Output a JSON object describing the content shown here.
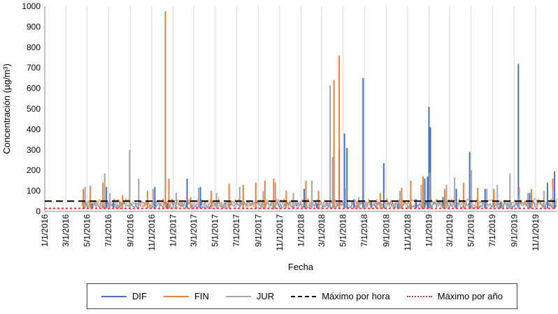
{
  "chart_data": {
    "type": "line",
    "xlabel": "Fecha",
    "ylabel": "Concentración (µg/m³)",
    "ylim": [
      0,
      1000
    ],
    "yticks": [
      "0",
      "100",
      "200",
      "300",
      "400",
      "500",
      "600",
      "700",
      "800",
      "900",
      "1000"
    ],
    "xticks": [
      "1/1/2016",
      "3/1/2016",
      "5/1/2016",
      "7/1/2016",
      "9/1/2016",
      "11/1/2016",
      "1/1/2017",
      "3/1/2017",
      "5/1/2017",
      "7/1/2017",
      "9/1/2017",
      "11/1/2017",
      "1/1/2018",
      "3/1/2018",
      "5/1/2018",
      "7/1/2018",
      "9/1/2018",
      "11/1/2018",
      "1/1/2019",
      "3/1/2019",
      "5/1/2019",
      "7/1/2019",
      "9/1/2019",
      "11/1/2019"
    ],
    "xlim": [
      "2016-01-01",
      "2019-12-31"
    ],
    "grid": "vertical",
    "legend_position": "bottom",
    "series": [
      {
        "name": "DIF",
        "color": "#4472c4",
        "x": [
          "2016-05-15",
          "2016-06-25",
          "2016-07-15",
          "2016-11-10",
          "2016-12-15",
          "2017-02-10",
          "2017-03-20",
          "2018-01-10",
          "2018-02-15",
          "2018-04-20",
          "2018-05-05",
          "2018-05-12",
          "2018-06-01",
          "2018-06-27",
          "2018-07-20",
          "2018-08-25",
          "2018-10-05",
          "2018-11-25",
          "2018-12-20",
          "2018-12-28",
          "2019-01-01",
          "2019-01-05",
          "2019-02-10",
          "2019-03-20",
          "2019-04-27",
          "2019-06-10",
          "2019-07-25",
          "2019-09-13",
          "2019-10-15",
          "2019-12-05",
          "2019-12-25"
        ],
        "y": [
          40,
          120,
          50,
          120,
          40,
          160,
          120,
          110,
          40,
          300,
          380,
          310,
          60,
          650,
          50,
          235,
          40,
          60,
          160,
          170,
          510,
          410,
          70,
          110,
          290,
          110,
          50,
          720,
          90,
          140,
          195
        ]
      },
      {
        "name": "FIN",
        "color": "#ed7d31",
        "x": [
          "2016-04-20",
          "2016-05-10",
          "2016-06-15",
          "2016-08-10",
          "2016-10-20",
          "2016-12-10",
          "2016-12-20",
          "2017-01-10",
          "2017-02-20",
          "2017-04-20",
          "2017-06-10",
          "2017-07-20",
          "2017-08-25",
          "2017-09-20",
          "2017-10-15",
          "2017-11-20",
          "2018-01-15",
          "2018-02-20",
          "2018-03-25",
          "2018-04-05",
          "2018-04-20",
          "2018-06-10",
          "2018-08-15",
          "2018-10-15",
          "2018-11-10",
          "2018-12-15",
          "2019-02-15",
          "2019-04-10",
          "2019-05-20",
          "2019-07-05",
          "2019-09-15",
          "2019-10-20",
          "2019-12-20"
        ],
        "y": [
          110,
          125,
          140,
          80,
          100,
          975,
          160,
          90,
          70,
          100,
          135,
          130,
          140,
          150,
          160,
          100,
          150,
          100,
          60,
          640,
          760,
          50,
          90,
          115,
          150,
          170,
          110,
          140,
          115,
          110,
          120,
          110,
          160
        ]
      },
      {
        "name": "JUR",
        "color": "#a5a5a5",
        "x": [
          "2016-04-25",
          "2016-06-20",
          "2016-07-05",
          "2016-08-30",
          "2016-09-25",
          "2016-11-05",
          "2017-01-10",
          "2017-03-15",
          "2017-05-05",
          "2017-07-10",
          "2017-09-15",
          "2017-10-20",
          "2017-12-10",
          "2018-02-01",
          "2018-03-25",
          "2018-04-01",
          "2018-05-10",
          "2018-06-15",
          "2018-08-05",
          "2018-10-10",
          "2018-12-10",
          "2019-01-03",
          "2019-02-20",
          "2019-03-15",
          "2019-05-02",
          "2019-06-15",
          "2019-07-15",
          "2019-08-20",
          "2019-09-15",
          "2019-10-10",
          "2019-11-25",
          "2019-12-20"
        ],
        "y": [
          120,
          185,
          90,
          300,
          160,
          110,
          90,
          115,
          90,
          120,
          100,
          140,
          90,
          150,
          615,
          265,
          110,
          70,
          60,
          100,
          130,
          190,
          130,
          165,
          200,
          110,
          130,
          185,
          80,
          90,
          100,
          110
        ]
      }
    ],
    "thresholds": [
      {
        "name": "Máximo por hora",
        "value": 50,
        "color": "#000000",
        "style": "dashed"
      },
      {
        "name": "Máximo por año",
        "value": 15,
        "color": "#e03131",
        "style": "dotted"
      }
    ]
  }
}
